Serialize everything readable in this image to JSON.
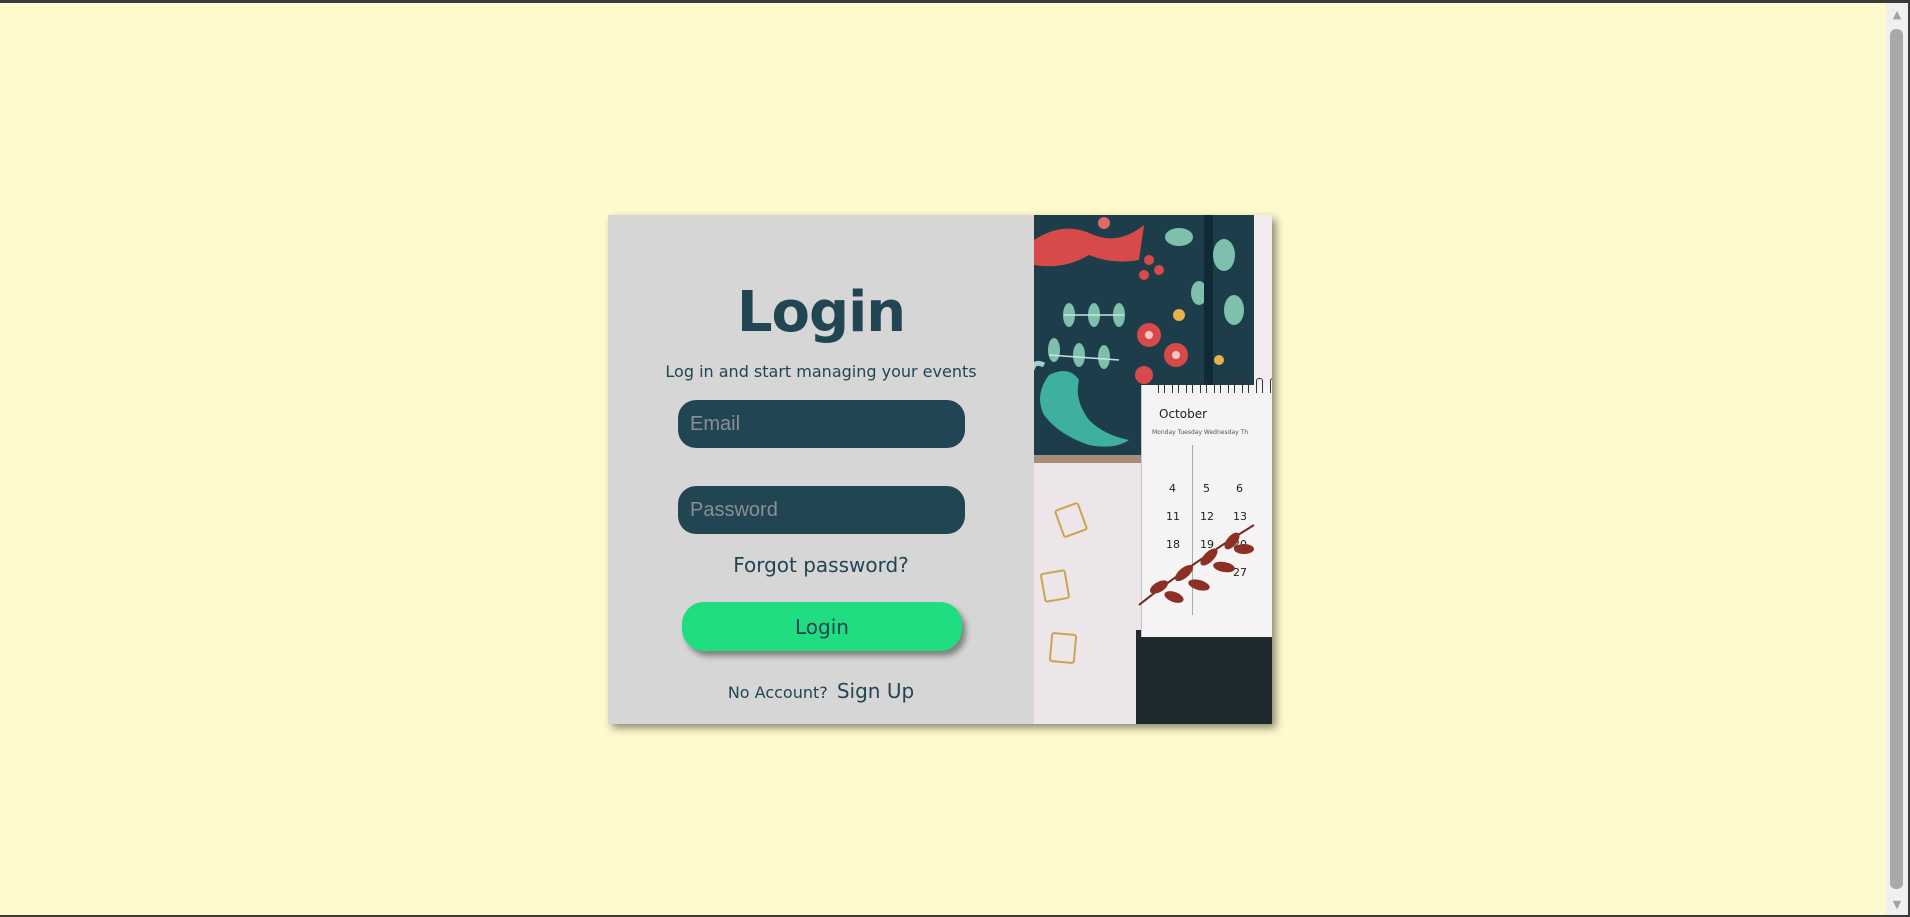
{
  "login": {
    "title": "Login",
    "subtitle": "Log in and start managing your events",
    "email_placeholder": "Email",
    "password_placeholder": "Password",
    "forgot_label": "Forgot password?",
    "login_button_label": "Login",
    "no_account_text": "No Account?",
    "signup_label": "Sign Up"
  },
  "image": {
    "calendar_month": "October",
    "calendar_day_headers": "Monday  Tuesday  Wednesday  Th",
    "calendar_numbers": [
      "4",
      "5",
      "6",
      "11",
      "12",
      "13",
      "18",
      "19",
      "20",
      "27"
    ]
  },
  "colors": {
    "page_background": "#fffacd",
    "panel_background": "#d6d6d6",
    "primary_dark": "#224553",
    "accent_green": "#1fdd80"
  }
}
